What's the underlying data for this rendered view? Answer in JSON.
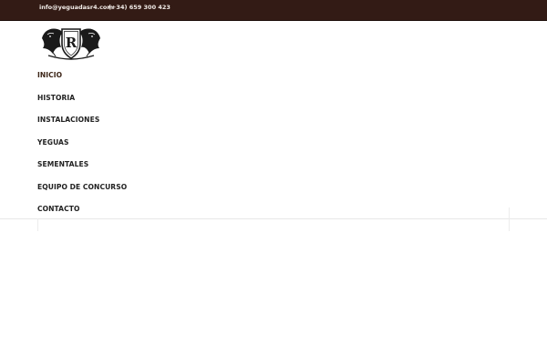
{
  "topbar": {
    "email": "info@yeguadasr4.com",
    "phone": "(+34) 659 300 423"
  },
  "logo": {
    "icon": "horse-crest-logo-icon",
    "monogram": "R"
  },
  "nav": {
    "items": [
      {
        "label": "INICIO",
        "active": true
      },
      {
        "label": "HISTORIA"
      },
      {
        "label": "INSTALACIONES"
      },
      {
        "label": "YEGUAS"
      },
      {
        "label": "SEMENTALES"
      },
      {
        "label": "EQUIPO DE CONCURSO"
      },
      {
        "label": "CONTACTO"
      }
    ]
  },
  "colors": {
    "topbar_bg": "#331b15",
    "active_nav": "#3b2416",
    "nav_text": "#222222"
  }
}
